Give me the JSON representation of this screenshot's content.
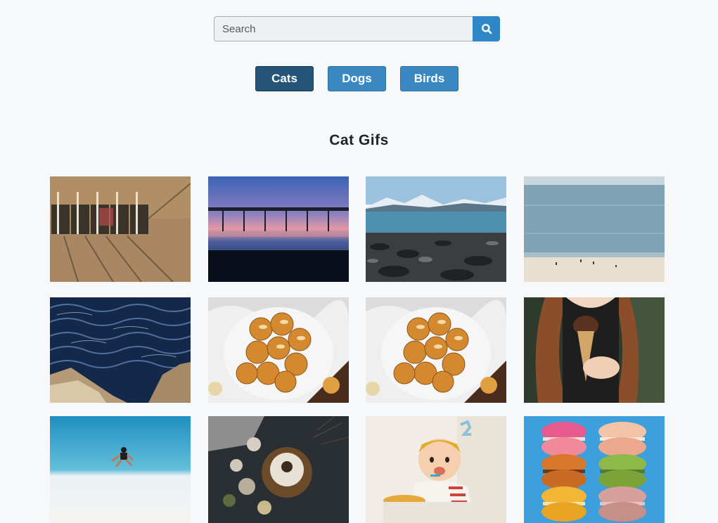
{
  "search": {
    "placeholder": "Search",
    "value": "",
    "button_icon": "search-icon"
  },
  "categories": [
    {
      "label": "Cats",
      "active": true
    },
    {
      "label": "Dogs",
      "active": false
    },
    {
      "label": "Birds",
      "active": false
    }
  ],
  "section": {
    "title": "Cat Gifs"
  },
  "colors": {
    "background": "#f6f8f9",
    "accent": "#2f86c4",
    "active_button": "#245579",
    "button": "#3a88c2"
  },
  "gallery": [
    {
      "scene": "sand-beach-aerial-chairs"
    },
    {
      "scene": "pier-at-sunset"
    },
    {
      "scene": "mountains-lake-rocky-shore"
    },
    {
      "scene": "calm-sea-beach"
    },
    {
      "scene": "dark-ocean-waves-rocks"
    },
    {
      "scene": "pastries-on-plate"
    },
    {
      "scene": "pastries-on-plate"
    },
    {
      "scene": "woman-holding-ice-cream"
    },
    {
      "scene": "person-jumping-beach"
    },
    {
      "scene": "dark-table-food"
    },
    {
      "scene": "baby-in-high-chair"
    },
    {
      "scene": "stacked-macarons"
    }
  ]
}
